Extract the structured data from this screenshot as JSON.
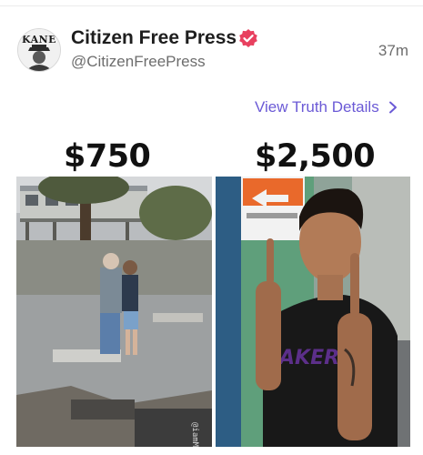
{
  "post": {
    "avatar_text": "KANE",
    "author_name": "Citizen Free Press",
    "handle": "@CitizenFreePress",
    "timestamp": "37m",
    "view_details": "View Truth Details"
  },
  "meme": {
    "left_price": "$750",
    "right_price": "$2,500",
    "watermark": "@iamMeme0"
  },
  "colors": {
    "accent": "#6b5ad6",
    "verified": "#e8405f"
  },
  "icons": {
    "verified": "verified-badge-icon",
    "chevron": "chevron-right-icon"
  }
}
